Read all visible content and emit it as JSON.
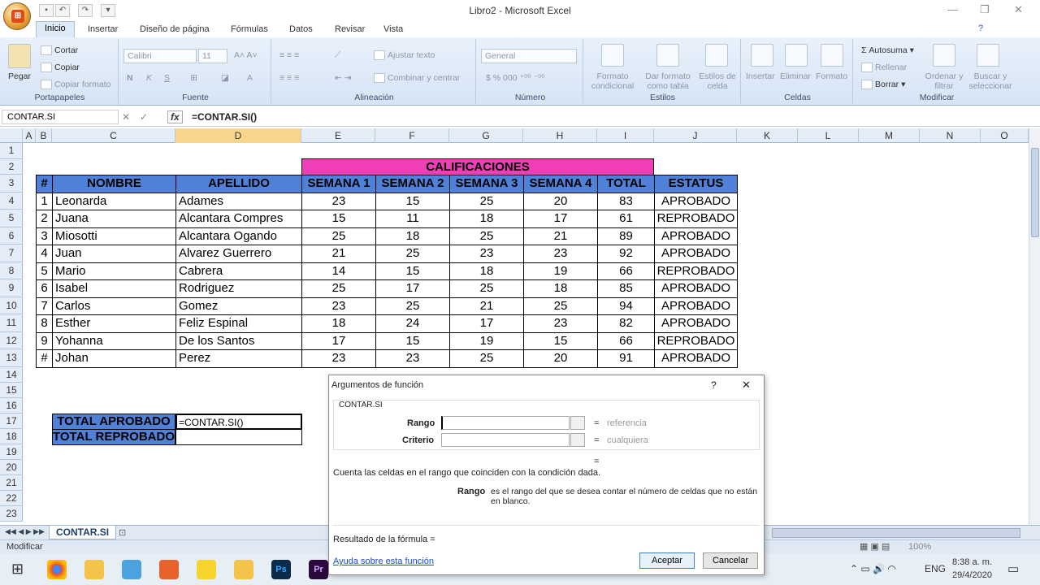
{
  "window": {
    "title": "Libro2 - Microsoft Excel",
    "minimize": "—",
    "restore": "❐",
    "close": "✕"
  },
  "ribbon_tabs": [
    "Inicio",
    "Insertar",
    "Diseño de página",
    "Fórmulas",
    "Datos",
    "Revisar",
    "Vista"
  ],
  "ribbon": {
    "portapapeles": {
      "label": "Portapapeles",
      "paste": "Pegar",
      "cut": "Cortar",
      "copy": "Copiar",
      "format_painter": "Copiar formato"
    },
    "fuente": {
      "label": "Fuente",
      "font": "Calibri",
      "size": "11"
    },
    "alineacion": {
      "label": "Alineación",
      "wrap": "Ajustar texto",
      "merge": "Combinar y centrar"
    },
    "numero": {
      "label": "Número",
      "format": "General"
    },
    "estilos": {
      "label": "Estilos",
      "cond": "Formato condicional",
      "table": "Dar formato como tabla",
      "cell": "Estilos de celda"
    },
    "celdas": {
      "label": "Celdas",
      "insert": "Insertar",
      "delete": "Eliminar",
      "format": "Formato"
    },
    "modificar": {
      "label": "Modificar",
      "autosum": "Autosuma",
      "fill": "Rellenar",
      "clear": "Borrar",
      "sort": "Ordenar y filtrar",
      "find": "Buscar y seleccionar"
    }
  },
  "formula_bar": {
    "name_box": "CONTAR.SI",
    "fx": "fx",
    "formula": "=CONTAR.SI()"
  },
  "columns": [
    "A",
    "B",
    "C",
    "D",
    "E",
    "F",
    "G",
    "H",
    "I",
    "J",
    "K",
    "L",
    "M",
    "N",
    "O"
  ],
  "rows": [
    "1",
    "2",
    "3",
    "4",
    "5",
    "6",
    "7",
    "8",
    "9",
    "10",
    "11",
    "12",
    "13",
    "14",
    "15",
    "16",
    "17",
    "18",
    "19",
    "20",
    "21",
    "22",
    "23"
  ],
  "table": {
    "title": "CALIFICACIONES",
    "headers": [
      "#",
      "NOMBRE",
      "APELLIDO",
      "SEMANA 1",
      "SEMANA 2",
      "SEMANA 3",
      "SEMANA 4",
      "TOTAL",
      "ESTATUS"
    ],
    "rows": [
      [
        "1",
        "Leonarda",
        "Adames",
        "23",
        "15",
        "25",
        "20",
        "83",
        "APROBADO"
      ],
      [
        "2",
        "Juana",
        "Alcantara Compres",
        "15",
        "11",
        "18",
        "17",
        "61",
        "REPROBADO"
      ],
      [
        "3",
        "Miosotti",
        "Alcantara Ogando",
        "25",
        "18",
        "25",
        "21",
        "89",
        "APROBADO"
      ],
      [
        "4",
        "Juan",
        "Alvarez Guerrero",
        "21",
        "25",
        "23",
        "23",
        "92",
        "APROBADO"
      ],
      [
        "5",
        "Mario",
        "Cabrera",
        "14",
        "15",
        "18",
        "19",
        "66",
        "REPROBADO"
      ],
      [
        "6",
        "Isabel",
        "Rodriguez",
        "25",
        "17",
        "25",
        "18",
        "85",
        "APROBADO"
      ],
      [
        "7",
        "Carlos",
        "Gomez",
        "23",
        "25",
        "21",
        "25",
        "94",
        "APROBADO"
      ],
      [
        "8",
        "Esther",
        "Feliz Espinal",
        "18",
        "24",
        "17",
        "23",
        "82",
        "APROBADO"
      ],
      [
        "9",
        "Yohanna",
        "De los Santos",
        "17",
        "15",
        "19",
        "15",
        "66",
        "REPROBADO"
      ],
      [
        "#",
        "Johan",
        "Perez",
        "23",
        "23",
        "25",
        "20",
        "91",
        "APROBADO"
      ]
    ]
  },
  "summary": {
    "aprobado_label": "TOTAL APROBADO",
    "reprobado_label": "TOTAL REPROBADOS",
    "active_value": "=CONTAR.SI()"
  },
  "sheet_tab": "CONTAR.SI",
  "status": {
    "mode": "Modificar",
    "zoom": "100%"
  },
  "dialog": {
    "title": "Argumentos de función",
    "help_q": "?",
    "close": "✕",
    "func": "CONTAR.SI",
    "rango_label": "Rango",
    "rango_hint": "referencia",
    "criterio_label": "Criterio",
    "criterio_hint": "cualquiera",
    "eq": "=",
    "description": "Cuenta las celdas en el rango que coinciden con la condición dada.",
    "arg_name": "Rango",
    "arg_desc": "es el rango del que se desea contar el número de celdas que no están en blanco.",
    "result": "Resultado de la fórmula =",
    "help_link": "Ayuda sobre esta función",
    "ok": "Aceptar",
    "cancel": "Cancelar"
  },
  "taskbar": {
    "lang": "ENG",
    "time": "8:38 a. m.",
    "date": "29/4/2020"
  },
  "colors": {
    "header_blue": "#4f81d9",
    "title_pink": "#ef3fb6",
    "selected": "#f8d58a"
  }
}
